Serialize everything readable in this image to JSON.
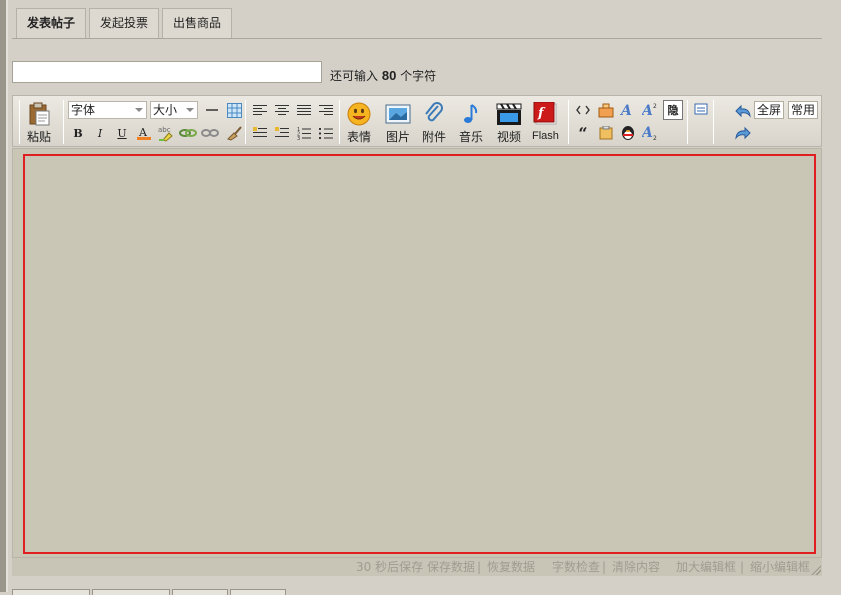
{
  "tabs": [
    {
      "label": "发表帖子",
      "active": true
    },
    {
      "label": "发起投票",
      "active": false
    },
    {
      "label": "出售商品",
      "active": false
    }
  ],
  "subject": {
    "value": "",
    "remain_prefix": "还可输入",
    "remain_count": "80",
    "remain_suffix": "个字符"
  },
  "toolbar": {
    "paste_label": "粘贴",
    "font_select": "字体",
    "size_select": "大小",
    "emoticon_label": "表情",
    "image_label": "图片",
    "attachment_label": "附件",
    "music_label": "音乐",
    "video_label": "视频",
    "flash_label": "Flash",
    "bold": "B",
    "italic": "I",
    "underline": "U",
    "hide_label": "隐",
    "fullscreen_label": "全屏",
    "common_label": "常用",
    "quote_glyph": "“"
  },
  "status": {
    "autosave": "30 秒后保存",
    "save_data": "保存数据",
    "restore_data": "恢复数据",
    "char_check": "字数检查",
    "clear": "清除内容",
    "enlarge": "加大编辑框",
    "shrink": "缩小编辑框",
    "divider": "|"
  },
  "colors": {
    "highlight_border": "#e02020",
    "canvas": "#cac6b6",
    "window": "#d4d0c8"
  }
}
